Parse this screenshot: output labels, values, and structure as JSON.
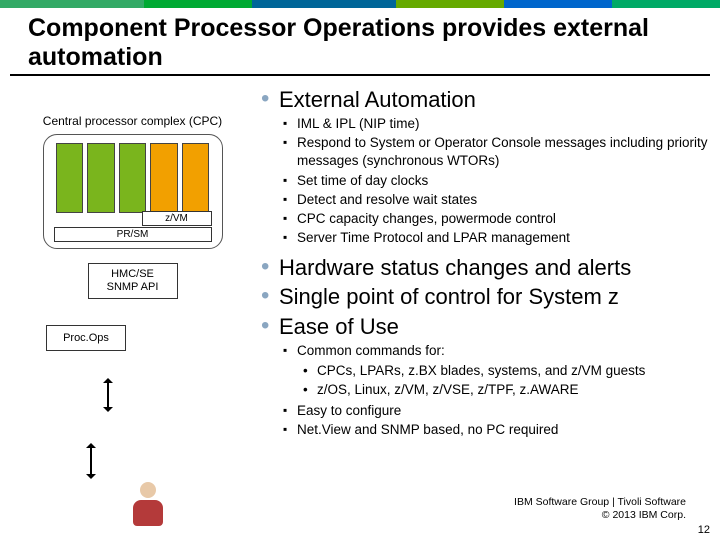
{
  "title": "Component Processor Operations provides external automation",
  "left": {
    "cpc_label": "Central processor complex (CPC)",
    "zvm": "z/VM",
    "prsm": "PR/SM",
    "hmc_line1": "HMC/SE",
    "hmc_line2": "SNMP API",
    "procops": "Proc.Ops"
  },
  "right": {
    "b1": "External Automation",
    "b1_sub": [
      "IML & IPL (NIP time)",
      "Respond to System or Operator Console messages including priority messages (synchronous WTORs)",
      "Set time of day clocks",
      "Detect and resolve wait states",
      "CPC capacity changes, powermode control",
      "Server Time Protocol and LPAR management"
    ],
    "b2": "Hardware status changes and alerts",
    "b3": "Single point of control for System z",
    "b4": "Ease of Use",
    "b4_sub1": "Common commands for:",
    "b4_sub1_items": [
      "CPCs,  LPARs, z.BX blades, systems, and z/VM guests",
      "z/OS, Linux, z/VM, z/VSE, z/TPF, z.AWARE"
    ],
    "b4_sub2": "Easy to configure",
    "b4_sub3": "Net.View and SNMP based, no PC required"
  },
  "footer": {
    "line1": "IBM Software Group | Tivoli Software",
    "line2": "© 2013 IBM Corp.",
    "page": "12"
  }
}
